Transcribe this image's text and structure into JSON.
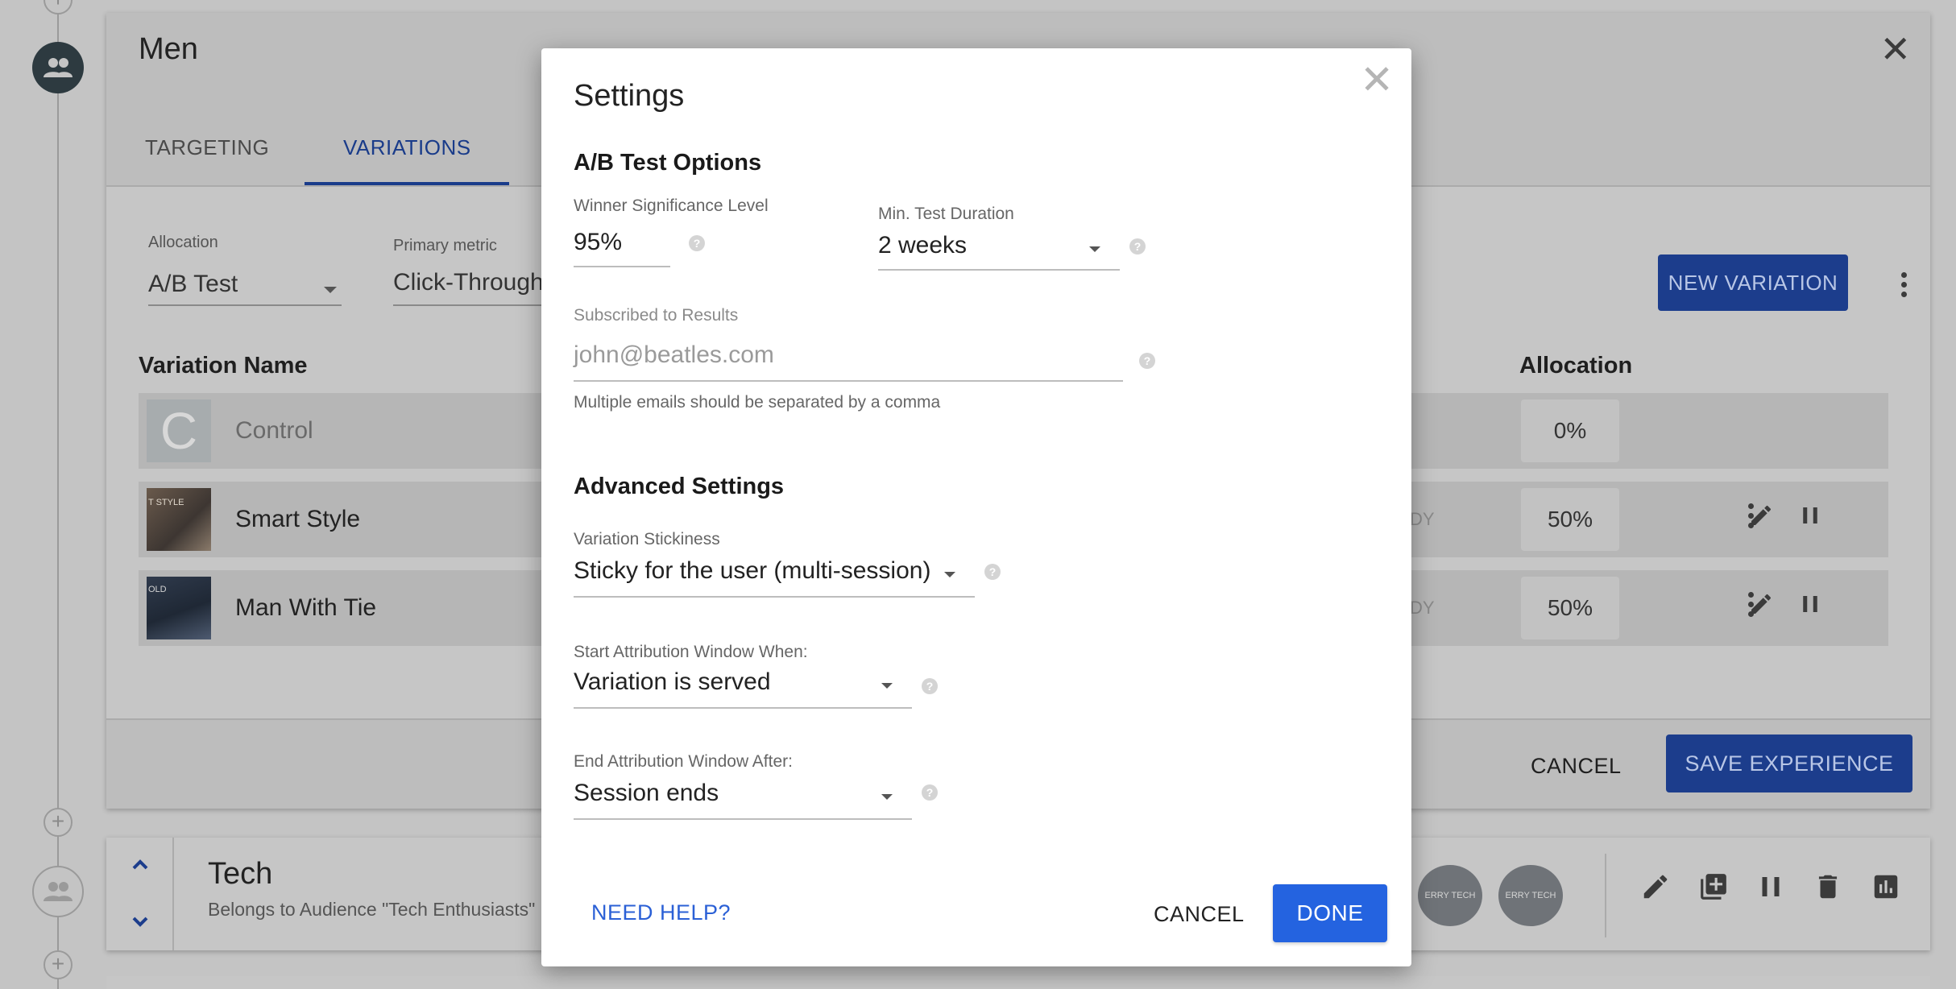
{
  "experience": {
    "title": "Men",
    "tabs": [
      {
        "label": "TARGETING"
      },
      {
        "label": "VARIATIONS"
      }
    ],
    "allocation": {
      "label": "Allocation",
      "value": "A/B Test"
    },
    "primary_metric": {
      "label": "Primary metric",
      "value": "Click-Through"
    },
    "new_variation_label": "NEW VARIATION",
    "columns": {
      "name": "Variation Name",
      "allocation": "Allocation"
    },
    "variations": [
      {
        "thumb": "C",
        "name": "Control",
        "status": "",
        "allocation": "0%"
      },
      {
        "thumb": "T STYLE",
        "name": "Smart Style",
        "status": "DY",
        "allocation": "50%"
      },
      {
        "thumb": "OLD",
        "name": "Man With Tie",
        "status": "DY",
        "allocation": "50%"
      }
    ],
    "cancel_label": "CANCEL",
    "save_label": "SAVE EXPERIENCE"
  },
  "tech": {
    "title": "Tech",
    "subtitle": "Belongs to Audience \"Tech Enthusiasts\"",
    "thumbs": [
      "ERRY TECH",
      "ERRY TECH"
    ]
  },
  "modal": {
    "title": "Settings",
    "ab_section": "A/B Test Options",
    "significance": {
      "label": "Winner Significance Level",
      "value": "95%"
    },
    "duration": {
      "label": "Min. Test Duration",
      "value": "2 weeks"
    },
    "subscribed": {
      "label": "Subscribed to Results",
      "placeholder": "john@beatles.com",
      "hint": "Multiple emails should be separated by a comma"
    },
    "advanced_section": "Advanced Settings",
    "stickiness": {
      "label": "Variation Stickiness",
      "value": "Sticky for the user (multi-session)"
    },
    "start_window": {
      "label": "Start Attribution Window When:",
      "value": "Variation is served"
    },
    "end_window": {
      "label": "End Attribution Window After:",
      "value": "Session ends"
    },
    "help_label": "NEED HELP?",
    "cancel_label": "CANCEL",
    "done_label": "DONE"
  }
}
